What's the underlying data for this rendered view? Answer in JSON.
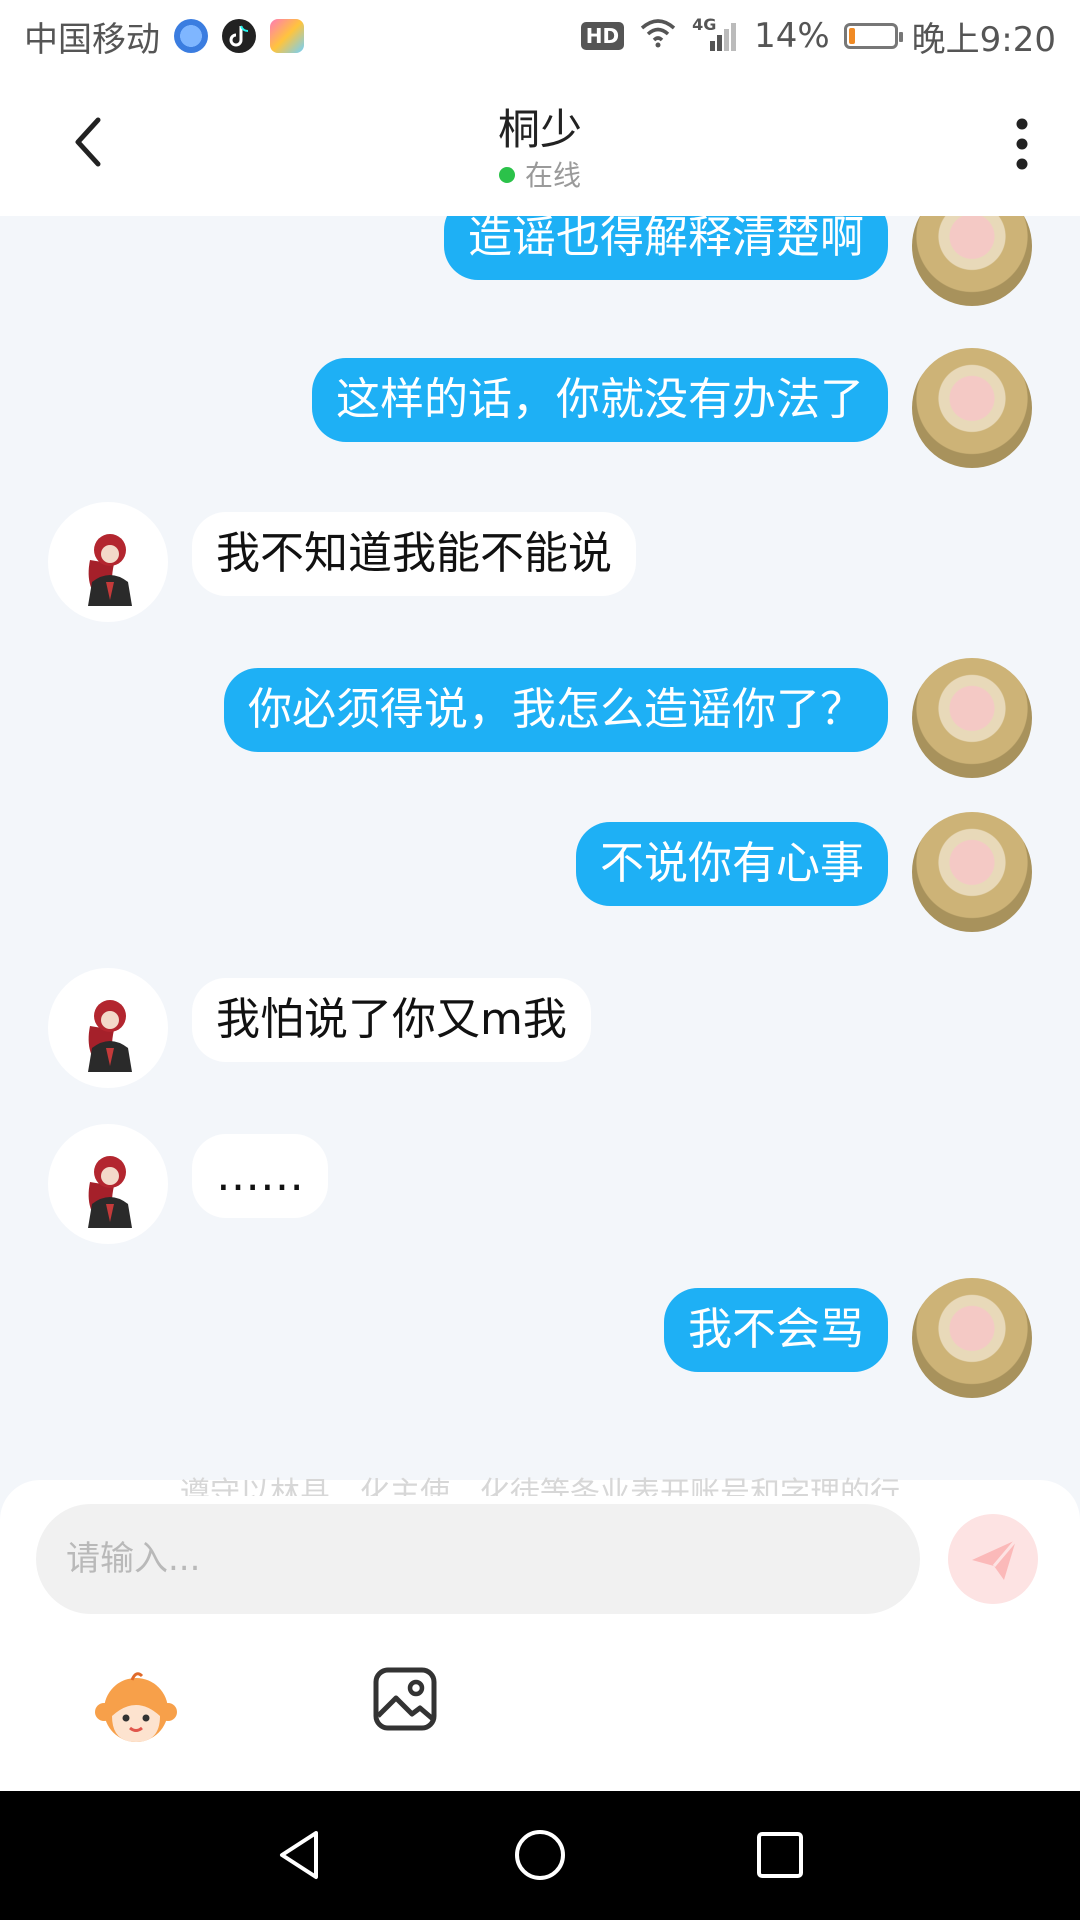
{
  "status_bar": {
    "carrier": "中国移动",
    "network": "4G",
    "battery_percent": "14%",
    "battery_level": 0.14,
    "time": "晚上9:20",
    "icons": [
      "globe-app-icon",
      "tiktok-app-icon",
      "colorful-app-icon",
      "hd-icon",
      "wifi-icon",
      "signal-icon",
      "battery-icon"
    ]
  },
  "header": {
    "title": "桐少",
    "status": "在线"
  },
  "chat": {
    "messages": [
      {
        "sender": "me",
        "text": "造谣也得解释清楚啊"
      },
      {
        "sender": "me",
        "text": "这样的话，你就没有办法了"
      },
      {
        "sender": "them",
        "text": "我不知道我能不能说"
      },
      {
        "sender": "me",
        "text": "你必须得说，我怎么造谣你了？"
      },
      {
        "sender": "me",
        "text": "不说你有心事"
      },
      {
        "sender": "them",
        "text": "我怕说了你又m我"
      },
      {
        "sender": "them",
        "text": "……"
      },
      {
        "sender": "me",
        "text": "我不会骂"
      }
    ]
  },
  "notice_partial": "遵守以林县，化主使，化徒等条业表开账号和字理的行",
  "input": {
    "placeholder": "请输入..."
  },
  "colors": {
    "my_bubble": "#1eb0f5",
    "their_bubble": "#ffffff",
    "chat_background": "#f3f6fa",
    "online_dot": "#2bc24a",
    "battery_low": "#f08a24"
  }
}
